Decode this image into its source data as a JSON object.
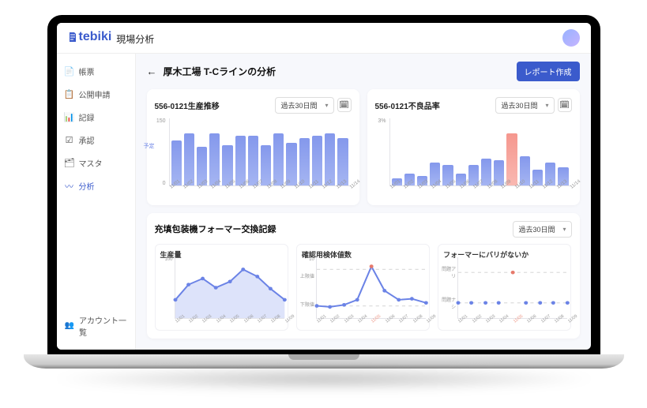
{
  "brand": {
    "name": "tebiki",
    "sub": "現場分析"
  },
  "sidebar": {
    "items": [
      {
        "icon": "📄",
        "label": "帳票"
      },
      {
        "icon": "📋",
        "label": "公開申請"
      },
      {
        "icon": "📊",
        "label": "記録"
      },
      {
        "icon": "☑",
        "label": "承認"
      },
      {
        "icon": "🗂",
        "label": "マスタ"
      },
      {
        "icon": "〰",
        "label": "分析"
      }
    ],
    "bottom": {
      "icon": "👥",
      "label": "アカウント一覧"
    }
  },
  "titlebar": {
    "back": "←",
    "title": "厚木工場 T-Cラインの分析",
    "button": "レポート作成"
  },
  "range_label": "過去30日間",
  "cards": {
    "c1": {
      "title": "556-0121生産推移",
      "target_label": "予定",
      "ylabels": [
        "150",
        "0"
      ],
      "xlabels": [
        "11/01",
        "11/02",
        "11/03",
        "11/04",
        "11/05",
        "11/06",
        "11/07",
        "11/08",
        "11/09",
        "11/10",
        "11/11",
        "11/12",
        "11/13",
        "11/14"
      ]
    },
    "c2": {
      "title": "556-0121不良品率",
      "ylabels": [
        "3%",
        ""
      ],
      "xlabels": [
        "11/01",
        "11/02",
        "11/03",
        "11/04",
        "11/05",
        "11/06",
        "11/07",
        "11/08",
        "11/09",
        "11/10",
        "11/11",
        "11/12",
        "11/13",
        "11/14"
      ]
    }
  },
  "section": {
    "title": "充填包装機フォーマー交換記録",
    "sub1": "生産量",
    "sub2": "確認用検体値数",
    "sub3": "フォーマーにバリがないか",
    "y1": [
      "100",
      ""
    ],
    "y2": [
      "10",
      "上限値",
      "",
      "下限値",
      ""
    ],
    "y3": [
      "",
      "問題アリ",
      "",
      "問題ナシ",
      ""
    ],
    "x": [
      "11/01",
      "11/02",
      "11/03",
      "11/04",
      "11/05",
      "11/06",
      "11/07",
      "11/08",
      "11/09"
    ]
  },
  "chart_data": [
    {
      "type": "bar",
      "title": "556-0121生産推移",
      "xlabel": "",
      "ylabel": "",
      "ylim": [
        0,
        150
      ],
      "categories": [
        "11/01",
        "11/02",
        "11/03",
        "11/04",
        "11/05",
        "11/06",
        "11/07",
        "11/08",
        "11/09",
        "11/10",
        "11/11",
        "11/12",
        "11/13",
        "11/14"
      ],
      "values": [
        100,
        115,
        85,
        115,
        90,
        110,
        110,
        90,
        115,
        95,
        105,
        110,
        115,
        105
      ],
      "target": 105
    },
    {
      "type": "bar",
      "title": "556-0121不良品率",
      "xlabel": "",
      "ylabel": "%",
      "ylim": [
        0,
        3
      ],
      "categories": [
        "11/01",
        "11/02",
        "11/03",
        "11/04",
        "11/05",
        "11/06",
        "11/07",
        "11/08",
        "11/09",
        "11/10",
        "11/11",
        "11/12",
        "11/13",
        "11/14"
      ],
      "values": [
        0.3,
        0.5,
        0.4,
        1.0,
        0.9,
        0.5,
        0.9,
        1.2,
        1.1,
        2.3,
        1.3,
        0.7,
        1.0,
        0.8
      ],
      "highlight_index": 9
    },
    {
      "type": "area",
      "title": "生産量",
      "xlabel": "",
      "ylabel": "",
      "ylim": [
        0,
        100
      ],
      "x": [
        "11/01",
        "11/02",
        "11/03",
        "11/04",
        "11/05",
        "11/06",
        "11/07",
        "11/08",
        "11/09"
      ],
      "values": [
        30,
        55,
        65,
        50,
        60,
        80,
        68,
        48,
        30
      ]
    },
    {
      "type": "line",
      "title": "確認用検体値数",
      "xlabel": "",
      "ylabel": "",
      "ylim": [
        0,
        10
      ],
      "upper": 8,
      "lower": 2,
      "x": [
        "11/01",
        "11/02",
        "11/03",
        "11/04",
        "11/05",
        "11/06",
        "11/07",
        "11/08",
        "11/09"
      ],
      "values": [
        2.0,
        1.8,
        2.2,
        3.0,
        8.5,
        4.5,
        3.0,
        3.2,
        2.5
      ],
      "highlight_index": 4
    },
    {
      "type": "scatter",
      "title": "フォーマーにバリがないか",
      "xlabel": "",
      "ylabel": "",
      "categories_y": [
        "問題アリ",
        "問題ナシ"
      ],
      "x": [
        "11/01",
        "11/02",
        "11/03",
        "11/04",
        "11/05",
        "11/06",
        "11/07",
        "11/08",
        "11/09"
      ],
      "values": [
        "問題ナシ",
        "問題ナシ",
        "問題ナシ",
        "問題ナシ",
        "問題アリ",
        "問題ナシ",
        "問題ナシ",
        "問題ナシ",
        "問題ナシ"
      ],
      "highlight_index": 4
    }
  ]
}
